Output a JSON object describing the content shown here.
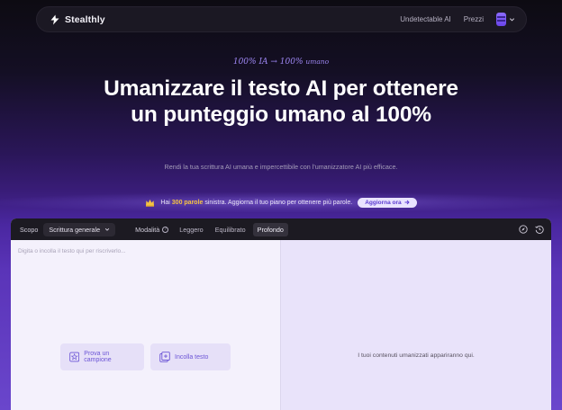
{
  "nav": {
    "brand": "Stealthly",
    "links": [
      "Undetectable AI",
      "Prezzi"
    ]
  },
  "hero": {
    "eyebrow_main": "100% IA → 100%",
    "eyebrow_small": "umano",
    "title": "Umanizzare il testo AI per ottenere un punteggio umano al 100%",
    "subtitle": "Rendi la tua scrittura AI umana e impercettibile con l'umanizzatore AI più efficace."
  },
  "promo": {
    "prefix": "Hai ",
    "highlight": "300 parole",
    "suffix": " sinistra. Aggiorna il tuo piano per ottenere più parole.",
    "button": "Aggiorna ora"
  },
  "toolbar": {
    "scope_label": "Scopo",
    "scope_value": "Scrittura generale",
    "mode_label": "Modalità",
    "modes": [
      "Leggero",
      "Equilibrato",
      "Profondo"
    ],
    "active_mode": "Profondo"
  },
  "editor": {
    "placeholder": "Digita o incolla il testo qui per riscriverlo...",
    "sample_button": "Prova un campione",
    "paste_button": "Incolla testo",
    "output_empty": "I tuoi contenuti umanizzati appariranno qui."
  },
  "colors": {
    "accent": "#6c55d6",
    "highlight": "#f5c242",
    "navbar": "#1b1823"
  }
}
